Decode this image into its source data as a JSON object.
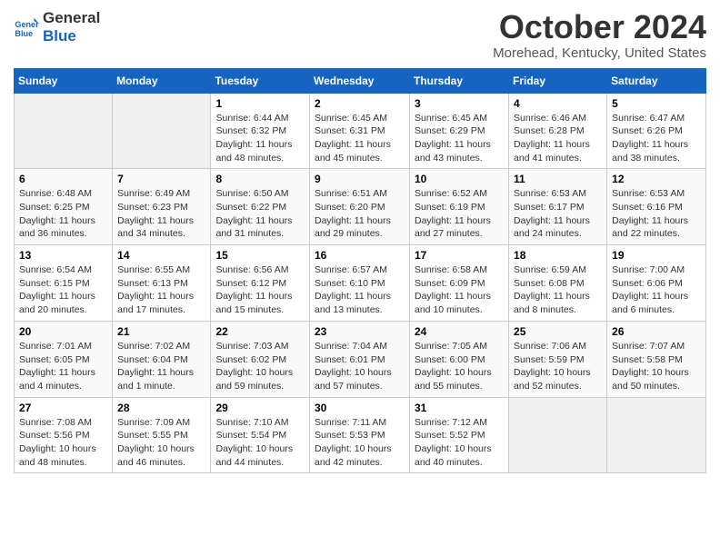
{
  "header": {
    "logo_line1": "General",
    "logo_line2": "Blue",
    "month": "October 2024",
    "location": "Morehead, Kentucky, United States"
  },
  "weekdays": [
    "Sunday",
    "Monday",
    "Tuesday",
    "Wednesday",
    "Thursday",
    "Friday",
    "Saturday"
  ],
  "weeks": [
    [
      {
        "day": "",
        "info": ""
      },
      {
        "day": "",
        "info": ""
      },
      {
        "day": "1",
        "info": "Sunrise: 6:44 AM\nSunset: 6:32 PM\nDaylight: 11 hours and 48 minutes."
      },
      {
        "day": "2",
        "info": "Sunrise: 6:45 AM\nSunset: 6:31 PM\nDaylight: 11 hours and 45 minutes."
      },
      {
        "day": "3",
        "info": "Sunrise: 6:45 AM\nSunset: 6:29 PM\nDaylight: 11 hours and 43 minutes."
      },
      {
        "day": "4",
        "info": "Sunrise: 6:46 AM\nSunset: 6:28 PM\nDaylight: 11 hours and 41 minutes."
      },
      {
        "day": "5",
        "info": "Sunrise: 6:47 AM\nSunset: 6:26 PM\nDaylight: 11 hours and 38 minutes."
      }
    ],
    [
      {
        "day": "6",
        "info": "Sunrise: 6:48 AM\nSunset: 6:25 PM\nDaylight: 11 hours and 36 minutes."
      },
      {
        "day": "7",
        "info": "Sunrise: 6:49 AM\nSunset: 6:23 PM\nDaylight: 11 hours and 34 minutes."
      },
      {
        "day": "8",
        "info": "Sunrise: 6:50 AM\nSunset: 6:22 PM\nDaylight: 11 hours and 31 minutes."
      },
      {
        "day": "9",
        "info": "Sunrise: 6:51 AM\nSunset: 6:20 PM\nDaylight: 11 hours and 29 minutes."
      },
      {
        "day": "10",
        "info": "Sunrise: 6:52 AM\nSunset: 6:19 PM\nDaylight: 11 hours and 27 minutes."
      },
      {
        "day": "11",
        "info": "Sunrise: 6:53 AM\nSunset: 6:17 PM\nDaylight: 11 hours and 24 minutes."
      },
      {
        "day": "12",
        "info": "Sunrise: 6:53 AM\nSunset: 6:16 PM\nDaylight: 11 hours and 22 minutes."
      }
    ],
    [
      {
        "day": "13",
        "info": "Sunrise: 6:54 AM\nSunset: 6:15 PM\nDaylight: 11 hours and 20 minutes."
      },
      {
        "day": "14",
        "info": "Sunrise: 6:55 AM\nSunset: 6:13 PM\nDaylight: 11 hours and 17 minutes."
      },
      {
        "day": "15",
        "info": "Sunrise: 6:56 AM\nSunset: 6:12 PM\nDaylight: 11 hours and 15 minutes."
      },
      {
        "day": "16",
        "info": "Sunrise: 6:57 AM\nSunset: 6:10 PM\nDaylight: 11 hours and 13 minutes."
      },
      {
        "day": "17",
        "info": "Sunrise: 6:58 AM\nSunset: 6:09 PM\nDaylight: 11 hours and 10 minutes."
      },
      {
        "day": "18",
        "info": "Sunrise: 6:59 AM\nSunset: 6:08 PM\nDaylight: 11 hours and 8 minutes."
      },
      {
        "day": "19",
        "info": "Sunrise: 7:00 AM\nSunset: 6:06 PM\nDaylight: 11 hours and 6 minutes."
      }
    ],
    [
      {
        "day": "20",
        "info": "Sunrise: 7:01 AM\nSunset: 6:05 PM\nDaylight: 11 hours and 4 minutes."
      },
      {
        "day": "21",
        "info": "Sunrise: 7:02 AM\nSunset: 6:04 PM\nDaylight: 11 hours and 1 minute."
      },
      {
        "day": "22",
        "info": "Sunrise: 7:03 AM\nSunset: 6:02 PM\nDaylight: 10 hours and 59 minutes."
      },
      {
        "day": "23",
        "info": "Sunrise: 7:04 AM\nSunset: 6:01 PM\nDaylight: 10 hours and 57 minutes."
      },
      {
        "day": "24",
        "info": "Sunrise: 7:05 AM\nSunset: 6:00 PM\nDaylight: 10 hours and 55 minutes."
      },
      {
        "day": "25",
        "info": "Sunrise: 7:06 AM\nSunset: 5:59 PM\nDaylight: 10 hours and 52 minutes."
      },
      {
        "day": "26",
        "info": "Sunrise: 7:07 AM\nSunset: 5:58 PM\nDaylight: 10 hours and 50 minutes."
      }
    ],
    [
      {
        "day": "27",
        "info": "Sunrise: 7:08 AM\nSunset: 5:56 PM\nDaylight: 10 hours and 48 minutes."
      },
      {
        "day": "28",
        "info": "Sunrise: 7:09 AM\nSunset: 5:55 PM\nDaylight: 10 hours and 46 minutes."
      },
      {
        "day": "29",
        "info": "Sunrise: 7:10 AM\nSunset: 5:54 PM\nDaylight: 10 hours and 44 minutes."
      },
      {
        "day": "30",
        "info": "Sunrise: 7:11 AM\nSunset: 5:53 PM\nDaylight: 10 hours and 42 minutes."
      },
      {
        "day": "31",
        "info": "Sunrise: 7:12 AM\nSunset: 5:52 PM\nDaylight: 10 hours and 40 minutes."
      },
      {
        "day": "",
        "info": ""
      },
      {
        "day": "",
        "info": ""
      }
    ]
  ]
}
